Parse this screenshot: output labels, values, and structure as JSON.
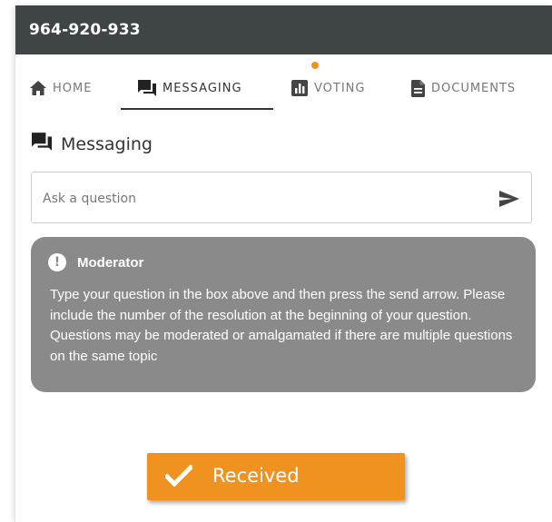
{
  "header": {
    "title": "964-920-933"
  },
  "tabs": [
    {
      "label": "HOME",
      "icon": "home-icon"
    },
    {
      "label": "MESSAGING",
      "icon": "chat-icon",
      "active": true
    },
    {
      "label": "VOTING",
      "icon": "bar-chart-icon",
      "has_notification": true
    },
    {
      "label": "DOCUMENTS",
      "icon": "document-icon"
    }
  ],
  "section": {
    "title": "Messaging",
    "icon": "chat-icon"
  },
  "ask": {
    "placeholder": "Ask a question",
    "value": ""
  },
  "moderator": {
    "name": "Moderator",
    "message": "Type your question in the box above and then press the send arrow. Please include the number of the resolution at the beginning of your question. Questions may be moderated or amalgamated if there are multiple questions on the same topic"
  },
  "toast": {
    "label": "Received",
    "icon": "check-icon"
  },
  "colors": {
    "header_bg": "#3f4444",
    "accent": "#f0921f",
    "card_bg": "#8a8a8a",
    "active_tab": "#333333",
    "inactive_tab": "#777777"
  }
}
